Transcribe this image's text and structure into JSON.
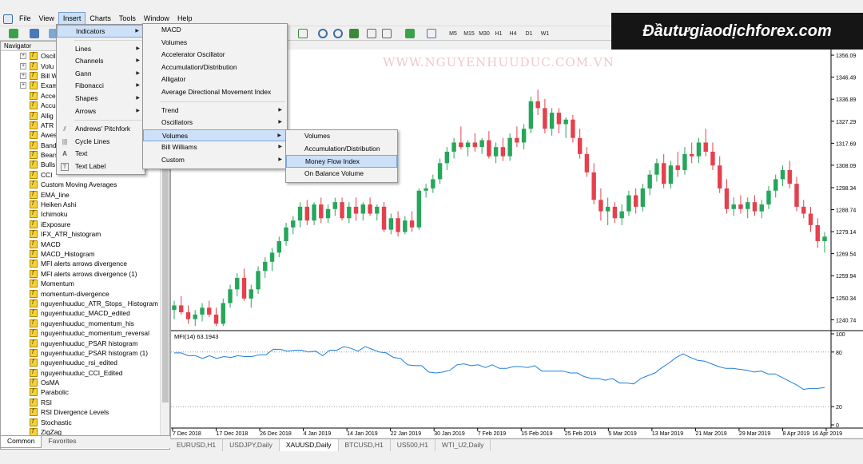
{
  "menubar": {
    "items": [
      "File",
      "View",
      "Insert",
      "Charts",
      "Tools",
      "Window",
      "Help"
    ]
  },
  "toolbar": {
    "timeframes": [
      "M5",
      "M15",
      "M30",
      "H1",
      "H4",
      "D1",
      "W1"
    ]
  },
  "brand": {
    "text": "Đầutưgiaodịchforex.com"
  },
  "navigator": {
    "title": "Navigator",
    "groups": [
      "Oscil",
      "Volu",
      "Bill W",
      "Exam"
    ],
    "items": [
      "Acce",
      "Accu",
      "Allig",
      "ATR",
      "Awes",
      "Band",
      "Bears",
      "Bulls",
      "CCI",
      "Custom Moving Averages",
      "EMA_line",
      "Heiken Ashi",
      "Ichimoku",
      "iExposure",
      "IFX_ATR_histogram",
      "MACD",
      "MACD_Histogram",
      "MFI alerts arrows divergence",
      "MFI alerts arrows divergence (1)",
      "Momentum",
      "momentum-divergence",
      "nguyenhuuduc_ATR_Stops_ Histogram",
      "nguyenhuuduc_MACD_edited",
      "nguyenhuuduc_momentum_his",
      "nguyenhuuduc_momentum_reversal",
      "nguyenhuuduc_PSAR histogram",
      "nguyenhuuduc_PSAR histogram (1)",
      "nguyenhuuduc_rsi_edited",
      "nguyenhuuduc_CCI_Edited",
      "OsMA",
      "Parabolic",
      "RSI",
      "RSI Divergence Levels",
      "Stochastic",
      "ZigZag"
    ],
    "tabs": [
      "Common",
      "Favorites"
    ]
  },
  "insert_menu": {
    "items": [
      "Indicators",
      "Lines",
      "Channels",
      "Gann",
      "Fibonacci",
      "Shapes",
      "Arrows",
      "Andrews' Pitchfork",
      "Cycle Lines",
      "Text",
      "Text Label"
    ]
  },
  "indicators_menu": {
    "top": [
      "MACD",
      "Volumes",
      "Accelerator Oscillator",
      "Accumulation/Distribution",
      "Alligator",
      "Average Directional Movement Index"
    ],
    "sub": [
      "Trend",
      "Oscillators",
      "Volumes",
      "Bill Williams",
      "Custom"
    ]
  },
  "volumes_menu": {
    "items": [
      "Volumes",
      "Accumulation/Distribution",
      "Money Flow Index",
      "On Balance Volume"
    ]
  },
  "chart": {
    "watermark": "WWW.NGUYENHUUDUC.COM.VN",
    "indicator_label": "MFI(14) 63.1943",
    "price_ticks": [
      "1356.09",
      "1346.49",
      "1336.89",
      "1327.29",
      "1317.69",
      "1308.09",
      "1298.34",
      "1288.74",
      "1279.14",
      "1269.54",
      "1259.94",
      "1250.34",
      "1240.74"
    ],
    "mfi_ticks": [
      "100",
      "80",
      "20",
      "0"
    ],
    "date_ticks": [
      "7 Dec 2018",
      "17 Dec 2018",
      "26 Dec 2018",
      "4 Jan 2019",
      "14 Jan 2019",
      "22 Jan 2019",
      "30 Jan 2019",
      "7 Feb 2019",
      "15 Feb 2019",
      "25 Feb 2019",
      "5 Mar 2019",
      "13 Mar 2019",
      "21 Mar 2019",
      "29 Mar 2019",
      "8 Apr 2019",
      "16 Apr 2019"
    ],
    "tabs": [
      "EURUSD,H1",
      "USDJPY,Daily",
      "XAUUSD,Daily",
      "BTCUSD,H1",
      "US500,H1",
      "WTI_U2,Daily"
    ],
    "active_tab": "XAUUSD,Daily",
    "colors": {
      "bull": "#26a65b",
      "bear": "#e5404d",
      "mfi_line": "#1e7fd8"
    },
    "candles": [
      [
        1245,
        1249,
        1241,
        1247
      ],
      [
        1247,
        1251,
        1243,
        1244
      ],
      [
        1244,
        1247,
        1239,
        1241
      ],
      [
        1241,
        1245,
        1238,
        1243
      ],
      [
        1243,
        1248,
        1240,
        1246
      ],
      [
        1246,
        1249,
        1242,
        1243
      ],
      [
        1243,
        1246,
        1238,
        1239
      ],
      [
        1239,
        1250,
        1238,
        1248
      ],
      [
        1248,
        1256,
        1246,
        1254
      ],
      [
        1254,
        1261,
        1251,
        1259
      ],
      [
        1259,
        1263,
        1249,
        1250
      ],
      [
        1250,
        1256,
        1246,
        1254
      ],
      [
        1254,
        1264,
        1252,
        1262
      ],
      [
        1262,
        1268,
        1259,
        1266
      ],
      [
        1266,
        1272,
        1262,
        1270
      ],
      [
        1270,
        1277,
        1268,
        1275
      ],
      [
        1275,
        1283,
        1273,
        1281
      ],
      [
        1281,
        1286,
        1278,
        1284
      ],
      [
        1284,
        1292,
        1281,
        1290
      ],
      [
        1290,
        1293,
        1282,
        1284
      ],
      [
        1284,
        1292,
        1282,
        1291
      ],
      [
        1291,
        1294,
        1283,
        1285
      ],
      [
        1285,
        1291,
        1283,
        1289
      ],
      [
        1289,
        1294,
        1286,
        1292
      ],
      [
        1292,
        1294,
        1284,
        1285
      ],
      [
        1285,
        1292,
        1283,
        1290
      ],
      [
        1290,
        1294,
        1284,
        1287
      ],
      [
        1287,
        1292,
        1284,
        1291
      ],
      [
        1291,
        1294,
        1286,
        1287
      ],
      [
        1287,
        1291,
        1284,
        1290
      ],
      [
        1290,
        1292,
        1279,
        1280
      ],
      [
        1280,
        1287,
        1278,
        1285
      ],
      [
        1285,
        1288,
        1277,
        1279
      ],
      [
        1279,
        1286,
        1278,
        1284
      ],
      [
        1284,
        1288,
        1279,
        1281
      ],
      [
        1281,
        1298,
        1280,
        1297
      ],
      [
        1297,
        1300,
        1294,
        1298
      ],
      [
        1298,
        1304,
        1296,
        1302
      ],
      [
        1302,
        1311,
        1300,
        1309
      ],
      [
        1309,
        1316,
        1306,
        1314
      ],
      [
        1314,
        1320,
        1311,
        1318
      ],
      [
        1318,
        1325,
        1315,
        1316
      ],
      [
        1316,
        1319,
        1312,
        1318
      ],
      [
        1318,
        1322,
        1314,
        1316
      ],
      [
        1316,
        1320,
        1313,
        1319
      ],
      [
        1319,
        1323,
        1311,
        1312
      ],
      [
        1312,
        1318,
        1309,
        1316
      ],
      [
        1316,
        1320,
        1310,
        1312
      ],
      [
        1312,
        1322,
        1310,
        1320
      ],
      [
        1320,
        1325,
        1316,
        1318
      ],
      [
        1318,
        1326,
        1315,
        1324
      ],
      [
        1324,
        1338,
        1322,
        1336
      ],
      [
        1336,
        1341,
        1330,
        1333
      ],
      [
        1333,
        1337,
        1322,
        1324
      ],
      [
        1324,
        1333,
        1321,
        1331
      ],
      [
        1331,
        1333,
        1322,
        1326
      ],
      [
        1326,
        1329,
        1320,
        1328
      ],
      [
        1328,
        1330,
        1318,
        1320
      ],
      [
        1320,
        1324,
        1311,
        1313
      ],
      [
        1313,
        1316,
        1303,
        1305
      ],
      [
        1305,
        1309,
        1291,
        1293
      ],
      [
        1293,
        1298,
        1284,
        1288
      ],
      [
        1288,
        1294,
        1282,
        1290
      ],
      [
        1290,
        1292,
        1283,
        1285
      ],
      [
        1285,
        1291,
        1282,
        1288
      ],
      [
        1288,
        1297,
        1286,
        1295
      ],
      [
        1295,
        1298,
        1287,
        1290
      ],
      [
        1290,
        1300,
        1288,
        1298
      ],
      [
        1298,
        1306,
        1295,
        1304
      ],
      [
        1304,
        1311,
        1301,
        1309
      ],
      [
        1309,
        1313,
        1298,
        1300
      ],
      [
        1300,
        1310,
        1298,
        1308
      ],
      [
        1308,
        1314,
        1303,
        1306
      ],
      [
        1306,
        1316,
        1304,
        1313
      ],
      [
        1313,
        1318,
        1309,
        1312
      ],
      [
        1312,
        1320,
        1309,
        1318
      ],
      [
        1318,
        1324,
        1312,
        1314
      ],
      [
        1314,
        1318,
        1306,
        1308
      ],
      [
        1308,
        1312,
        1296,
        1298
      ],
      [
        1298,
        1302,
        1287,
        1289
      ],
      [
        1289,
        1294,
        1286,
        1291
      ],
      [
        1291,
        1295,
        1287,
        1289
      ],
      [
        1289,
        1294,
        1285,
        1292
      ],
      [
        1292,
        1295,
        1286,
        1288
      ],
      [
        1288,
        1293,
        1285,
        1291
      ],
      [
        1291,
        1299,
        1289,
        1297
      ],
      [
        1297,
        1304,
        1294,
        1302
      ],
      [
        1302,
        1308,
        1299,
        1306
      ],
      [
        1306,
        1310,
        1298,
        1300
      ],
      [
        1300,
        1303,
        1288,
        1290
      ],
      [
        1290,
        1293,
        1285,
        1287
      ],
      [
        1287,
        1290,
        1279,
        1282
      ],
      [
        1282,
        1285,
        1272,
        1275
      ],
      [
        1275,
        1279,
        1270,
        1277
      ]
    ],
    "mfi": [
      79,
      79,
      76,
      76,
      73,
      76,
      73,
      75,
      74,
      76,
      75,
      75,
      77,
      77,
      83,
      83,
      81,
      82,
      82,
      80,
      81,
      76,
      82,
      82,
      86,
      84,
      81,
      86,
      83,
      80,
      79,
      74,
      73,
      66,
      65,
      65,
      58,
      57,
      58,
      60,
      66,
      67,
      65,
      66,
      63,
      66,
      62,
      62,
      64,
      64,
      63,
      65,
      59,
      59,
      59,
      59,
      57,
      57,
      53,
      51,
      51,
      49,
      51,
      46,
      46,
      45,
      51,
      54,
      57,
      63,
      68,
      74,
      78,
      74,
      71,
      70,
      67,
      64,
      62,
      62,
      61,
      60,
      58,
      59,
      56,
      56,
      52,
      48,
      44,
      39,
      40,
      40,
      41
    ]
  }
}
